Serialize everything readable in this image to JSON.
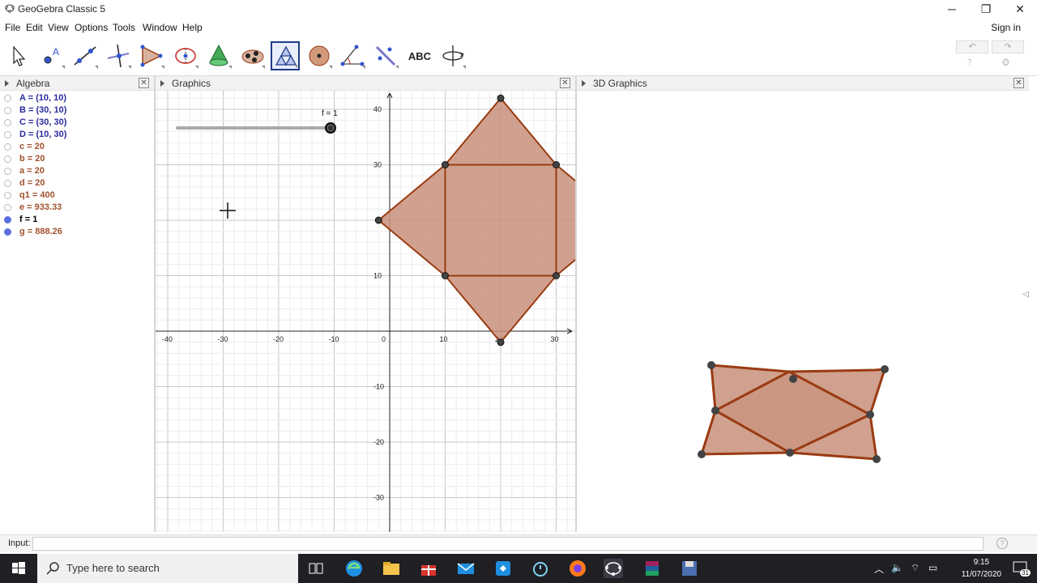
{
  "window": {
    "title": "GeoGebra Classic 5",
    "minimize": "─",
    "restore": "❐",
    "close": "✕"
  },
  "menu": {
    "items": [
      "File",
      "Edit",
      "View",
      "Options",
      "Tools",
      "Window",
      "Help"
    ],
    "sign_in": "Sign in"
  },
  "toolbar": {
    "tools": [
      "move-tool",
      "point-tool",
      "line-tool",
      "perpendicular-tool",
      "polygon-tool",
      "circle-tool",
      "cone-tool",
      "pyramid-tool",
      "net-tool",
      "sphere-tool",
      "angle-tool",
      "reflect-tool",
      "text-tool",
      "rotate-view-tool"
    ],
    "text_tool_label": "ABC",
    "selected_tool": "net-tool",
    "undo": "↶",
    "redo": "↷",
    "help": "?",
    "settings": "⚙"
  },
  "panels": {
    "algebra": {
      "title": "Algebra",
      "close": "✕"
    },
    "graphics": {
      "title": "Graphics",
      "close": "✕"
    },
    "graphics3d": {
      "title": "3D Graphics",
      "close": "✕"
    }
  },
  "algebra_items": [
    {
      "text": "A = (10, 10)",
      "color": "#2b2b9f",
      "shown": false
    },
    {
      "text": "B = (30, 10)",
      "color": "#2b2b9f",
      "shown": false
    },
    {
      "text": "C = (30, 30)",
      "color": "#2b2b9f",
      "shown": false
    },
    {
      "text": "D = (10, 30)",
      "color": "#2b2b9f",
      "shown": false
    },
    {
      "text": "c = 20",
      "color": "#a0522d",
      "shown": false
    },
    {
      "text": "b = 20",
      "color": "#a0522d",
      "shown": false
    },
    {
      "text": "a = 20",
      "color": "#a0522d",
      "shown": false
    },
    {
      "text": "d = 20",
      "color": "#a0522d",
      "shown": false
    },
    {
      "text": "q1 = 400",
      "color": "#a0522d",
      "shown": false
    },
    {
      "text": "e = 933.33",
      "color": "#a0522d",
      "shown": false
    },
    {
      "text": "f = 1",
      "color": "#000000",
      "shown": true
    },
    {
      "text": "g = 888.26",
      "color": "#a0522d",
      "shown": true
    }
  ],
  "graphics": {
    "slider_label": "f = 1",
    "slider_value": 1,
    "x_ticks": [
      "-40",
      "-30",
      "-20",
      "-10",
      "0",
      "10",
      "20",
      "30"
    ],
    "y_ticks": [
      "40",
      "30",
      "10",
      "-10",
      "-20",
      "-30"
    ],
    "fill_color": "#c8917a",
    "edge_color": "#9a3b12"
  },
  "input_bar": {
    "label": "Input:",
    "value": "",
    "help": "?"
  },
  "taskbar": {
    "search_placeholder": "Type here to search",
    "time": "9:15",
    "date": "11/07/2020",
    "notification_count": "31"
  }
}
